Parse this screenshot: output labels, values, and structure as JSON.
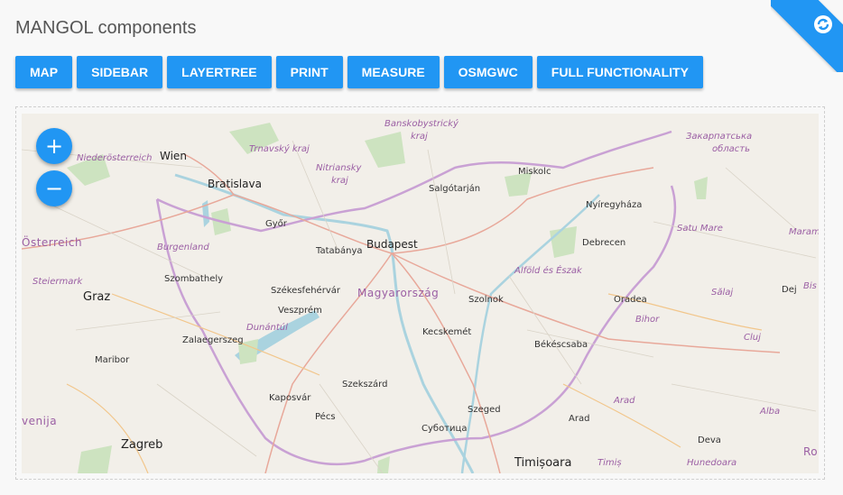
{
  "page": {
    "title": "MANGOL components"
  },
  "nav_buttons": [
    {
      "label": "MAP"
    },
    {
      "label": "SIDEBAR"
    },
    {
      "label": "LAYERTREE"
    },
    {
      "label": "PRINT"
    },
    {
      "label": "MEASURE"
    },
    {
      "label": "OSMGWC"
    },
    {
      "label": "FULL FUNCTIONALITY"
    }
  ],
  "corner": {
    "icon": "refresh-icon"
  },
  "map": {
    "zoom_in": "+",
    "zoom_out": "−",
    "labels": {
      "niederosterreich": "Niederösterreich",
      "wien": "Wien",
      "bratislava": "Bratislava",
      "trnavsky": "Trnavský kraj",
      "nitriansky1": "Nitriansky",
      "nitriansky2": "kraj",
      "banskobystricky1": "Banskobystrický",
      "banskobystricky2": "kraj",
      "miskolc": "Miskolc",
      "salgotarjan": "Salgótarján",
      "zakarpatska1": "Закарпатська",
      "zakarpatska2": "область",
      "nyiregyhaza": "Nyíregyháza",
      "osterreich": "Österreich",
      "gyor": "Győr",
      "budapest": "Budapest",
      "tatabanya": "Tatabánya",
      "debrecen": "Debrecen",
      "satu_mare": "Satu Mare",
      "maram": "Maram",
      "burgenland": "Burgenland",
      "alfold": "Alföld és Észak",
      "steiermark": "Steiermark",
      "szombathely": "Szombathely",
      "szekesfehervar": "Székesfehérvár",
      "magyarorszag": "Magyarország",
      "szolnok": "Szolnok",
      "oradea": "Oradea",
      "salaj": "Sălaj",
      "dej": "Dej",
      "bis": "Bis",
      "graz": "Graz",
      "veszprem": "Veszprém",
      "bihor": "Bihor",
      "dunantul": "Dunántúl",
      "kecskemet": "Kecskemét",
      "cluj": "Cluj",
      "zalaegerszeg": "Zalaegerszeg",
      "bekescsaba": "Békéscsaba",
      "maribor": "Maribor",
      "szekszard": "Szekszárd",
      "kaposvar": "Kaposvár",
      "arad_region": "Arad",
      "szeged": "Szeged",
      "venija": "venija",
      "pecs": "Pécs",
      "subotica": "Суботица",
      "arad": "Arad",
      "alba": "Alba",
      "zagreb": "Zagreb",
      "deva": "Deva",
      "ro": "Ro",
      "timisoara": "Timișoara",
      "timis": "Timiș",
      "hunedoara": "Hunedoara"
    }
  }
}
